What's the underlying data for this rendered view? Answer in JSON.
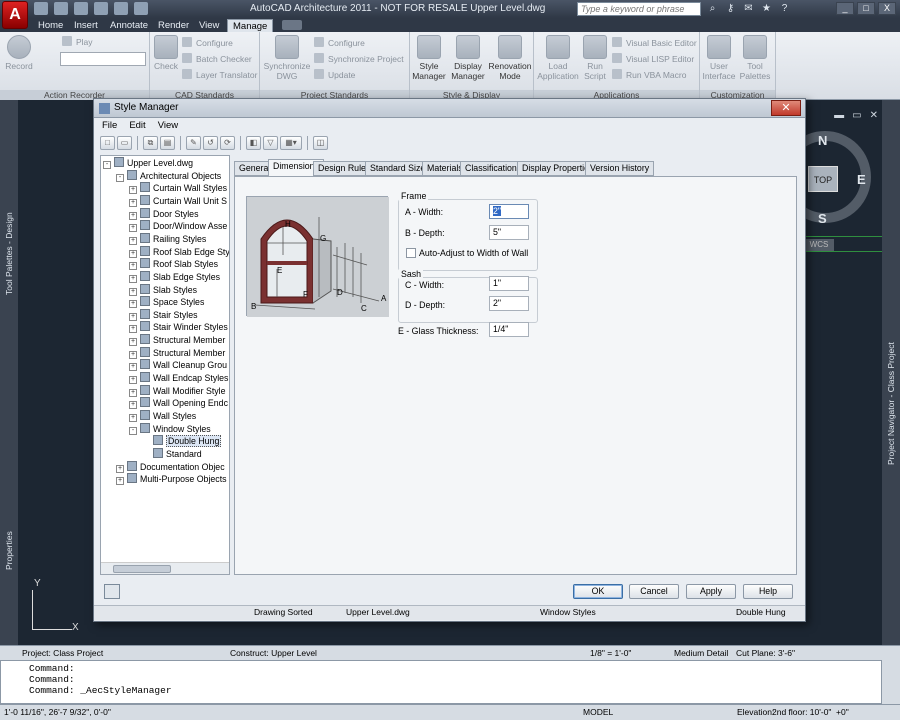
{
  "app": {
    "logo_letter": "A",
    "title": "AutoCAD Architecture 2011 - NOT FOR RESALE    Upper Level.dwg",
    "search_placeholder": "Type a keyword or phrase",
    "window_buttons": [
      "_",
      "□",
      "X"
    ]
  },
  "ribbon": {
    "tabs": [
      "Home",
      "Insert",
      "Annotate",
      "Render",
      "View",
      "Manage"
    ],
    "active_tab": "Manage",
    "groups": {
      "action_recorder": {
        "label": "Action Recorder",
        "record": "Record",
        "play": "Play"
      },
      "cad_standards": {
        "label": "CAD Standards",
        "check": "Check",
        "configure": "Configure",
        "batch_checker": "Batch Checker",
        "layer_translator": "Layer Translator"
      },
      "project_standards": {
        "label": "Project Standards",
        "synchronize_dwg_1": "Synchronize",
        "synchronize_dwg_2": "DWG",
        "configure": "Configure",
        "synchronize_project": "Synchronize Project",
        "update": "Update"
      },
      "style_display": {
        "label": "Style & Display",
        "style_manager_1": "Style",
        "style_manager_2": "Manager",
        "display_manager_1": "Display",
        "display_manager_2": "Manager",
        "renovation_mode_1": "Renovation",
        "renovation_mode_2": "Mode"
      },
      "applications": {
        "label": "Applications",
        "load_application_1": "Load",
        "load_application_2": "Application",
        "run_script_1": "Run",
        "run_script_2": "Script",
        "visual_basic_editor": "Visual Basic Editor",
        "visual_lisp_editor": "Visual LISP Editor",
        "run_vba_macro": "Run VBA Macro"
      },
      "customization": {
        "label": "Customization",
        "user_interface_1": "User",
        "user_interface_2": "Interface",
        "tool_palettes_1": "Tool",
        "tool_palettes_2": "Palettes"
      }
    }
  },
  "palettes": {
    "tool_palettes": "Tool Palettes - Design",
    "properties": "Properties",
    "project_navigator": "Project Navigator - Class Project"
  },
  "viewcube": {
    "top": "TOP",
    "north": "N",
    "south": "S",
    "east": "E",
    "wcs": "WCS"
  },
  "ucs": {
    "x": "X",
    "y": "Y"
  },
  "dialog": {
    "title": "Style Manager",
    "menus": [
      "File",
      "Edit",
      "View"
    ],
    "tree": [
      {
        "label": "Upper Level.dwg",
        "level": 0,
        "exp": "-"
      },
      {
        "label": "Architectural Objects",
        "level": 1,
        "exp": "-"
      },
      {
        "label": "Curtain Wall Styles",
        "level": 2,
        "exp": "+"
      },
      {
        "label": "Curtain Wall Unit S",
        "level": 2,
        "exp": "+"
      },
      {
        "label": "Door Styles",
        "level": 2,
        "exp": "+"
      },
      {
        "label": "Door/Window Asse",
        "level": 2,
        "exp": "+"
      },
      {
        "label": "Railing Styles",
        "level": 2,
        "exp": "+"
      },
      {
        "label": "Roof Slab Edge Sty",
        "level": 2,
        "exp": "+"
      },
      {
        "label": "Roof Slab Styles",
        "level": 2,
        "exp": "+"
      },
      {
        "label": "Slab Edge Styles",
        "level": 2,
        "exp": "+"
      },
      {
        "label": "Slab Styles",
        "level": 2,
        "exp": "+"
      },
      {
        "label": "Space Styles",
        "level": 2,
        "exp": "+"
      },
      {
        "label": "Stair Styles",
        "level": 2,
        "exp": "+"
      },
      {
        "label": "Stair Winder Styles",
        "level": 2,
        "exp": "+"
      },
      {
        "label": "Structural Member",
        "level": 2,
        "exp": "+"
      },
      {
        "label": "Structural Member",
        "level": 2,
        "exp": "+"
      },
      {
        "label": "Wall Cleanup Grou",
        "level": 2,
        "exp": "+"
      },
      {
        "label": "Wall Endcap Styles",
        "level": 2,
        "exp": "+"
      },
      {
        "label": "Wall Modifier Style",
        "level": 2,
        "exp": "+"
      },
      {
        "label": "Wall Opening Endc",
        "level": 2,
        "exp": "+"
      },
      {
        "label": "Wall Styles",
        "level": 2,
        "exp": "+"
      },
      {
        "label": "Window Styles",
        "level": 2,
        "exp": "-"
      },
      {
        "label": "Double Hung",
        "level": 3,
        "exp": "",
        "selected": true
      },
      {
        "label": "Standard",
        "level": 3,
        "exp": ""
      },
      {
        "label": "Documentation Objec",
        "level": 1,
        "exp": "+"
      },
      {
        "label": "Multi-Purpose Objects",
        "level": 1,
        "exp": "+"
      }
    ],
    "tabs": [
      "General",
      "Dimensions",
      "Design Rules",
      "Standard Sizes",
      "Materials",
      "Classifications",
      "Display Properties",
      "Version History"
    ],
    "active_tab": "Dimensions",
    "preview_labels": {
      "h": "H",
      "g": "G",
      "e": "E",
      "f": "F",
      "b": "B",
      "d": "D",
      "c": "C",
      "a": "A"
    },
    "frame": {
      "label": "Frame",
      "a_width_label": "A - Width:",
      "a_width_value": "2\"",
      "b_depth_label": "B - Depth:",
      "b_depth_value": "5\"",
      "auto_adjust_label": "Auto-Adjust to Width of Wall"
    },
    "sash": {
      "label": "Sash",
      "c_width_label": "C - Width:",
      "c_width_value": "1\"",
      "d_depth_label": "D - Depth:",
      "d_depth_value": "2\""
    },
    "glass": {
      "label": "E - Glass Thickness:",
      "value": "1/4\""
    },
    "buttons": {
      "ok": "OK",
      "cancel": "Cancel",
      "apply": "Apply",
      "help": "Help"
    },
    "status": {
      "drawing_sorted": "Drawing Sorted",
      "drawing": "Upper Level.dwg",
      "category": "Window Styles",
      "style": "Double Hung"
    }
  },
  "layout_status": {
    "project": "Project: Class Project",
    "construct": "Construct: Upper Level",
    "scale": "1/8\" = 1'-0\"",
    "detail": "Medium Detail",
    "cut_plane": "Cut Plane: 3'-6\""
  },
  "command": {
    "lines": [
      "Command:",
      "Command:",
      "Command:  _AecStyleManager"
    ]
  },
  "bottom_status": {
    "coords": "1'-0 11/16\", 26'-7 9/32\", 0'-0\"",
    "model": "MODEL",
    "elevation": "Elevation:",
    "floor": "2nd floor: 10'-0\"",
    "offset": "+0\""
  },
  "colors": {
    "accent_red": "#c0392b",
    "selection_blue": "#316ac5",
    "drawing_bg": "#1c2632"
  }
}
